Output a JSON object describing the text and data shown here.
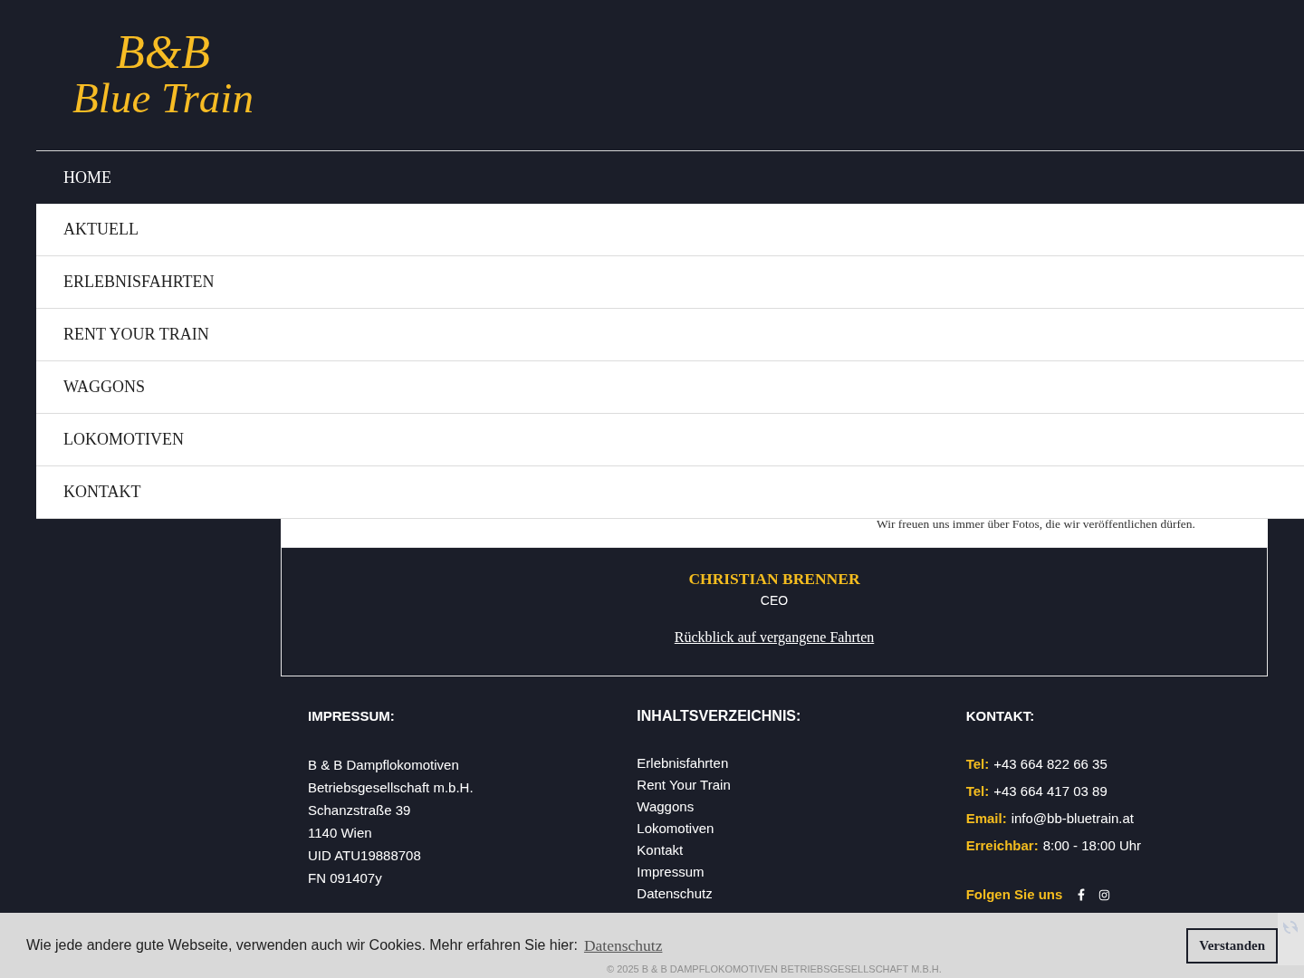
{
  "logo": {
    "line_1": "B&B",
    "line_2": "Blue Train"
  },
  "nav": {
    "items": [
      {
        "label": "HOME",
        "selected": true
      },
      {
        "label": "AKTUELL",
        "selected": false
      },
      {
        "label": "ERLEBNISFAHRTEN",
        "selected": false
      },
      {
        "label": "RENT YOUR TRAIN",
        "selected": false
      },
      {
        "label": "WAGGONS",
        "selected": false
      },
      {
        "label": "LOKOMOTIVEN",
        "selected": false
      },
      {
        "label": "KONTAKT",
        "selected": false
      }
    ]
  },
  "content": {
    "note": "Wir freuen uns immer über Fotos, die wir veröffentlichen dürfen.",
    "person": {
      "name": "CHRISTIAN BRENNER",
      "role": "CEO"
    },
    "link": "Rückblick auf vergangene Fahrten"
  },
  "footer": {
    "impressum": {
      "heading": "IMPRESSUM:",
      "lines": [
        "B & B Dampflokomotiven",
        "Betriebsgesellschaft m.b.H.",
        "Schanzstraße 39",
        "1140 Wien",
        "UID ATU19888708",
        "FN 091407y"
      ]
    },
    "index": {
      "heading": "INHALTSVERZEICHNIS:",
      "links": [
        "Erlebnisfahrten",
        "Rent Your Train",
        "Waggons",
        "Lokomotiven",
        "Kontakt",
        "Impressum",
        "Datenschutz"
      ]
    },
    "contact": {
      "heading": "KONTAKT:",
      "rows": [
        {
          "label": "Tel:",
          "value": "+43 664 822 66 35"
        },
        {
          "label": "Tel:",
          "value": "+43 664 417 03 89"
        },
        {
          "label": "Email:",
          "value": "info@bb-bluetrain.at"
        },
        {
          "label": "Erreichbar:",
          "value": "8:00 - 18:00 Uhr"
        }
      ],
      "social": {
        "label": "Folgen Sie uns",
        "links": [
          {
            "kind": "facebook"
          },
          {
            "kind": "instagram"
          }
        ]
      }
    },
    "copyright": "© 2025 B & B DAMPFLOKOMOTIVEN BETRIEBSGESELLSCHAFT M.B.H."
  },
  "cookie_banner": {
    "text": "Wie jede andere gute Webseite, verwenden auch wir Cookies. Mehr erfahren Sie hier:",
    "link": "Datenschutz",
    "button": "Verstanden"
  }
}
